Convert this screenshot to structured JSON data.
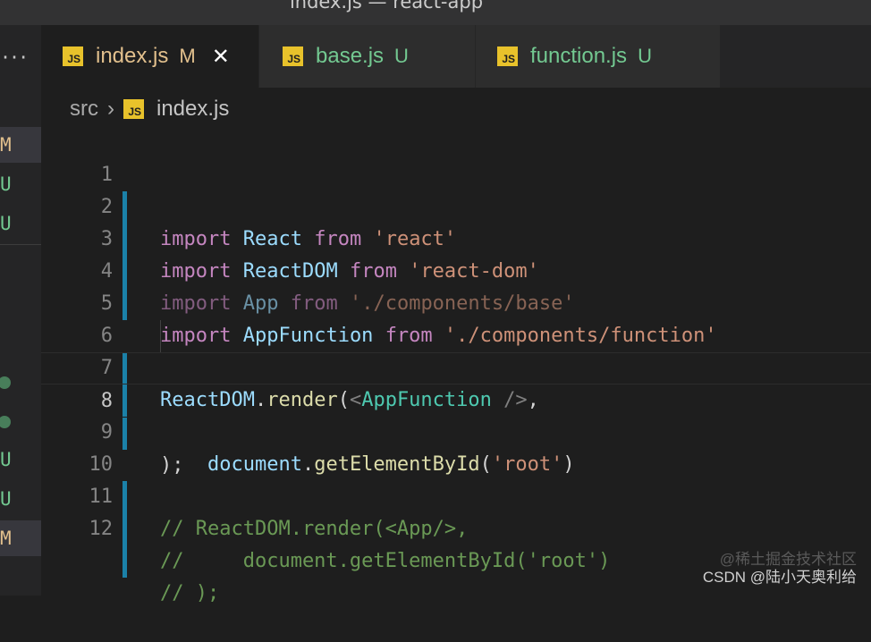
{
  "window": {
    "title": "index.js — react-app"
  },
  "sidebar": {
    "more": "···",
    "statuses": [
      "M",
      "U",
      "U",
      "U",
      "U",
      "M"
    ]
  },
  "tabs": [
    {
      "icon": "JS",
      "label": "index.js",
      "status": "M",
      "active": true,
      "close": "✕"
    },
    {
      "icon": "JS",
      "label": "base.js",
      "status": "U",
      "active": false
    },
    {
      "icon": "JS",
      "label": "function.js",
      "status": "U",
      "active": false
    }
  ],
  "breadcrumb": {
    "folder": "src",
    "separator": "›",
    "file": "index.js",
    "icon": "JS"
  },
  "editor": {
    "line_numbers": [
      "1",
      "2",
      "3",
      "4",
      "5",
      "6",
      "7",
      "8",
      "9",
      "10",
      "11",
      "12"
    ],
    "lines": [
      [
        "import",
        " ",
        "React",
        " ",
        "from",
        " ",
        "'react'"
      ],
      [
        "import",
        " ",
        "ReactDOM",
        " ",
        "from",
        " ",
        "'react-dom'"
      ],
      [
        "import",
        " ",
        "App",
        " ",
        "from",
        " ",
        "'./components/base'"
      ],
      [
        "import",
        " ",
        "AppFunction",
        " ",
        "from",
        " ",
        "'./components/function'"
      ],
      [],
      [
        "ReactDOM",
        ".",
        "render",
        "(",
        "<",
        "AppFunction",
        " ",
        "/>",
        ","
      ],
      [
        "    ",
        "document",
        ".",
        "getElementById",
        "(",
        "'root'",
        ")"
      ],
      [
        ")",
        ";"
      ],
      [],
      [
        "// ReactDOM.render(<App/>,"
      ],
      [
        "//     document.getElementById('root')"
      ],
      [
        "// );"
      ]
    ]
  },
  "watermark": {
    "line1": "@稀土掘金技术社区",
    "line2": "CSDN @陆小天奥利给"
  },
  "colors": {
    "keyword": "#c586c0",
    "variable": "#9cdcfe",
    "string": "#ce9178",
    "function": "#dcdcaa",
    "component": "#4ec9b0",
    "comment": "#6a9955",
    "modified": "#e2c08d",
    "untracked": "#73c991",
    "gutter_modified": "#1b81a8"
  }
}
